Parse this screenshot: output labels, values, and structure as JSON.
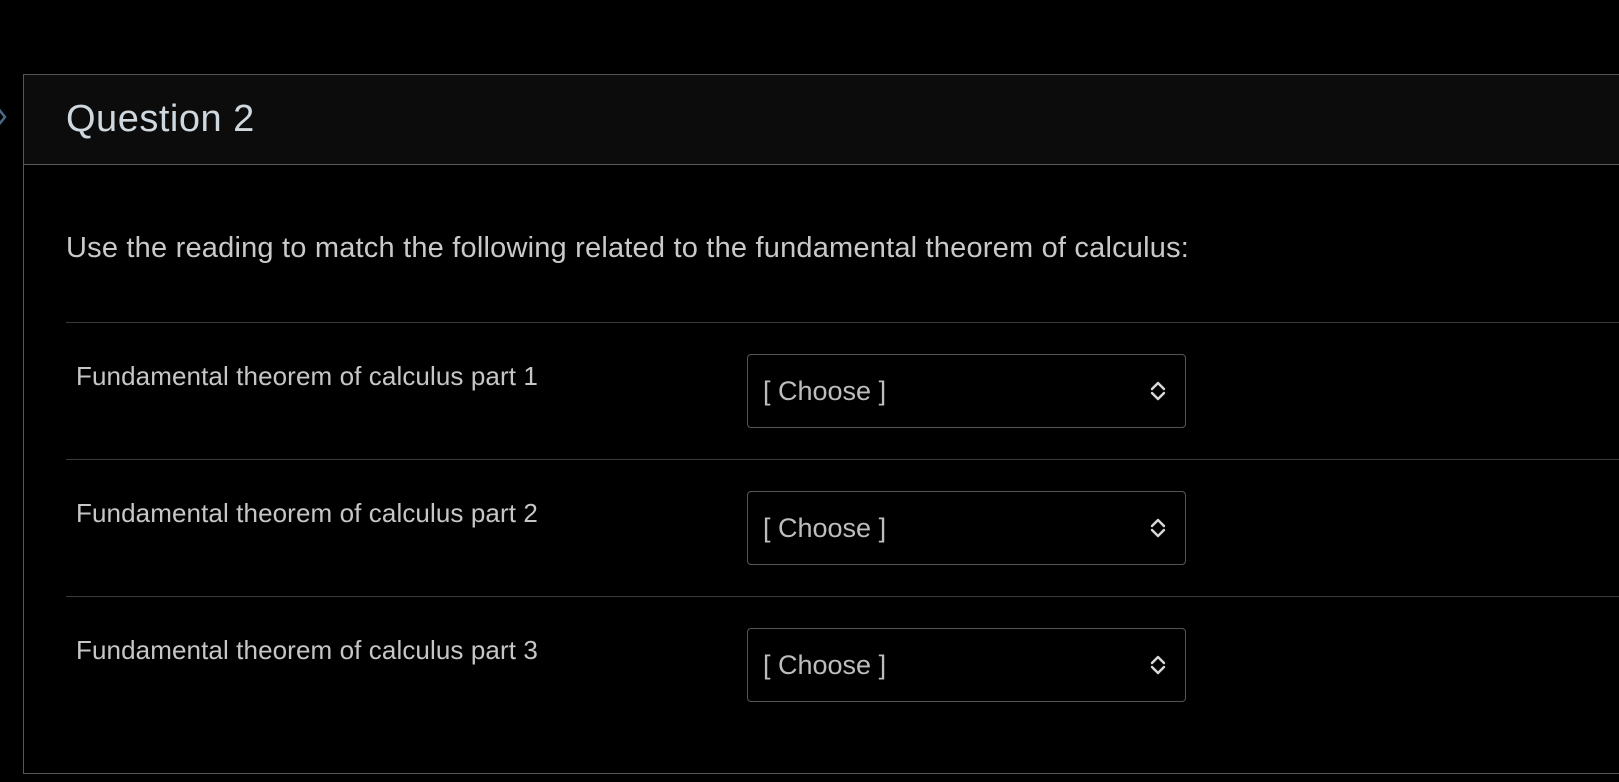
{
  "question": {
    "title": "Question 2",
    "prompt": "Use the reading to match the following related to the fundamental theorem of calculus:",
    "rows": [
      {
        "label": "Fundamental theorem of calculus part 1",
        "selected": "[ Choose ]"
      },
      {
        "label": "Fundamental theorem of calculus part 2",
        "selected": "[ Choose ]"
      },
      {
        "label": "Fundamental theorem of calculus part 3",
        "selected": "[ Choose ]"
      }
    ]
  },
  "colors": {
    "background": "#000000",
    "header_bg": "#0c0c0c",
    "border": "#555555",
    "title_text": "#cfd8de",
    "body_text": "#c9c9c9",
    "accent_arrow": "#4a6a8a"
  },
  "icons": {
    "select_indicator": "chevron-up-down-icon",
    "side_toggle": "chevron-right-icon"
  }
}
